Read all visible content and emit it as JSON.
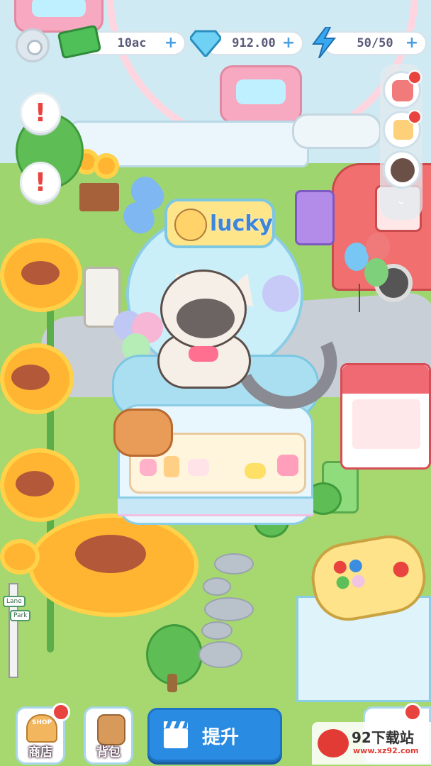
{
  "hud": {
    "cash": "10ac",
    "diamonds": "912.00",
    "energy": "50/50",
    "plus_symbol": "+",
    "icons": [
      "gear-icon",
      "cash-icon",
      "diamond-icon",
      "lightning-icon"
    ]
  },
  "alerts": [
    "!",
    "!"
  ],
  "sign_text": "lucky",
  "bottom_bar": {
    "shop_label": "商店",
    "shop_sign_text": "SHOP",
    "bag_label": "背包",
    "upgrade_label": "提升"
  },
  "signpost": [
    "Park",
    "Lane"
  ],
  "watermark": {
    "title": "92下载站",
    "url": "www.xz92.com"
  },
  "colors": {
    "upgrade_button": "#2a8be3",
    "alert_red": "#e8433e",
    "grass": "#a6d86f"
  }
}
